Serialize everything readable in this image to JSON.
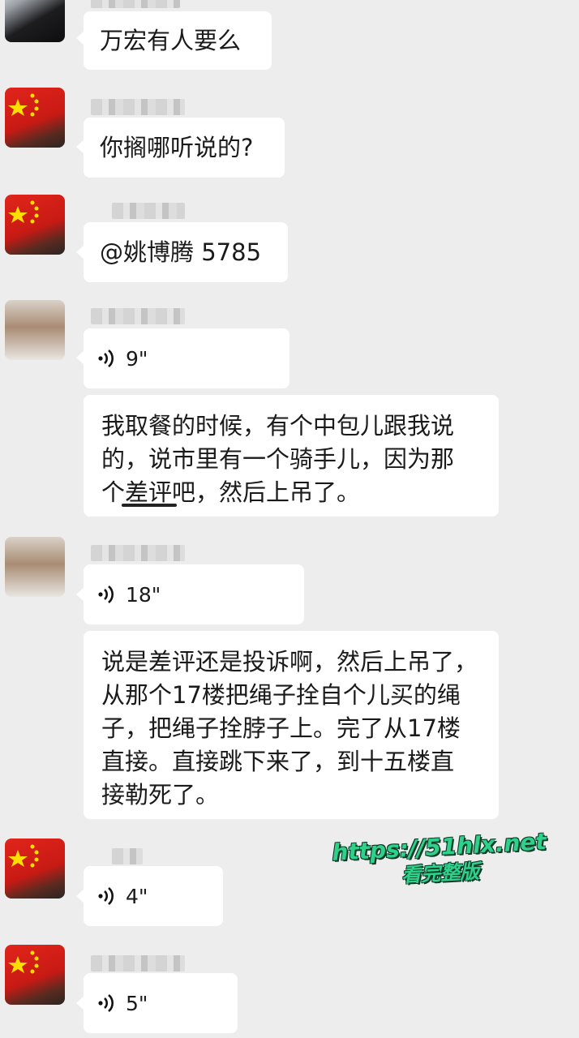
{
  "messages": [
    {
      "id": "m1",
      "type": "text",
      "text": "万宏有人要么"
    },
    {
      "id": "m2",
      "type": "text",
      "text": "你搁哪听说的?"
    },
    {
      "id": "m3",
      "type": "text",
      "text": "@姚博腾 5785"
    },
    {
      "id": "m4",
      "type": "voice",
      "duration": "9\""
    },
    {
      "id": "m5",
      "type": "text",
      "lines": [
        "我取餐的时候，有个中包儿跟我说",
        "的，说市里有一个骑手儿，因为那",
        "个差评吧，然后上吊了。"
      ]
    },
    {
      "id": "m6",
      "type": "voice",
      "duration": "18\""
    },
    {
      "id": "m7",
      "type": "text",
      "lines": [
        "说是差评还是投诉啊，然后上吊了，",
        "从那个17楼把绳子拴自个儿买的绳",
        "子，把绳子拴脖子上。完了从17楼",
        "直接。直接跳下来了，到十五楼直",
        "接勒死了。"
      ]
    },
    {
      "id": "m8",
      "type": "voice",
      "duration": "4\""
    },
    {
      "id": "m9",
      "type": "voice",
      "duration": "5\""
    }
  ],
  "watermark": {
    "url": "https://51hlx.net",
    "sub": "看完整版"
  },
  "colors": {
    "background": "#ededed",
    "bubble": "#ffffff",
    "watermark": "#2fd18a"
  }
}
